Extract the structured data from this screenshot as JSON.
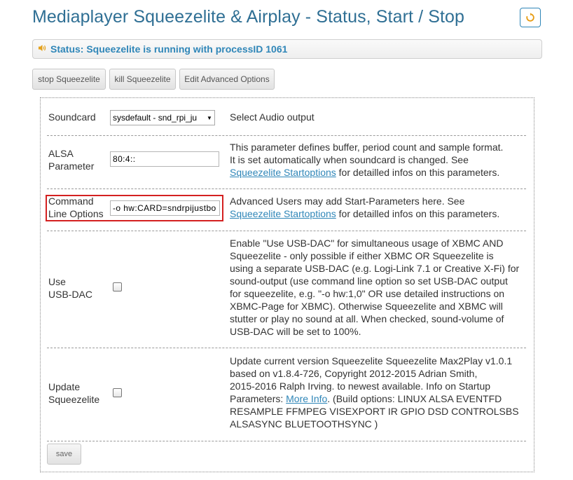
{
  "header": {
    "title": "Mediaplayer Squeezelite & Airplay - Status, Start / Stop",
    "refresh_icon": "refresh-icon"
  },
  "status": {
    "icon": "speaker-icon",
    "text": "Status: Squeezelite is running with processID 1061"
  },
  "toolbar": {
    "stop_label": "stop Squeezelite",
    "kill_label": "kill Squeezelite",
    "edit_label": "Edit Advanced Options"
  },
  "form": {
    "soundcard": {
      "label": "Soundcard",
      "value": "sysdefault - snd_rpi_ju",
      "description": "Select Audio output"
    },
    "alsa": {
      "label_line1": "ALSA",
      "label_line2": "Parameter",
      "value": "80:4::",
      "desc_line1": "This parameter defines buffer, period count and sample format.",
      "desc_line2": "It is set automatically when soundcard is changed. See",
      "link": "Squeezelite Startoptions",
      "desc_line3_rest": " for detailled infos on this parameters."
    },
    "command_line": {
      "label_line1": "Command",
      "label_line2": "Line Options",
      "value": "-o hw:CARD=sndrpijustbo",
      "desc_line1": "Advanced Users may add Start-Parameters here. See",
      "link": "Squeezelite Startoptions",
      "desc_line2_rest": " for detailled infos on this parameters."
    },
    "usb_dac": {
      "label_line1": "Use",
      "label_line2": "USB-DAC",
      "checked": false,
      "desc_lines": [
        "Enable \"Use USB-DAC\" for simultaneous usage of XBMC AND",
        "Squeezelite - only possible if either XBMC OR Squeezelite is",
        "using a separate USB-DAC (e.g. Logi-Link 7.1 or Creative X-Fi) for",
        "sound-output (use command line option so set USB-DAC output",
        "for squeezelite, e.g. \"-o hw:1,0\" OR use detailed instructions on",
        "XBMC-Page for XBMC). Otherwise Squeezelite and XBMC will",
        "stutter or play no sound at all. When checked, sound-volume of",
        "USB-DAC will be set to 100%."
      ]
    },
    "update": {
      "label_line1": "Update",
      "label_line2": "Squeezelite",
      "checked": false,
      "desc_line1": "Update current version Squeezelite Squeezelite Max2Play v1.0.1",
      "desc_line2": "based on v1.8.4-726, Copyright 2012-2015 Adrian Smith,",
      "desc_line3": "2015-2016 Ralph Irving. to newest available. Info on Startup",
      "desc_line4_pre": "Parameters: ",
      "link": "More Info",
      "desc_line4_post": ". (Build options: LINUX ALSA EVENTFD",
      "desc_line5": "RESAMPLE FFMPEG VISEXPORT IR GPIO DSD CONTROLSBS",
      "desc_line6": "ALSASYNC BLUETOOTHSYNC )"
    },
    "save_label": "save"
  }
}
